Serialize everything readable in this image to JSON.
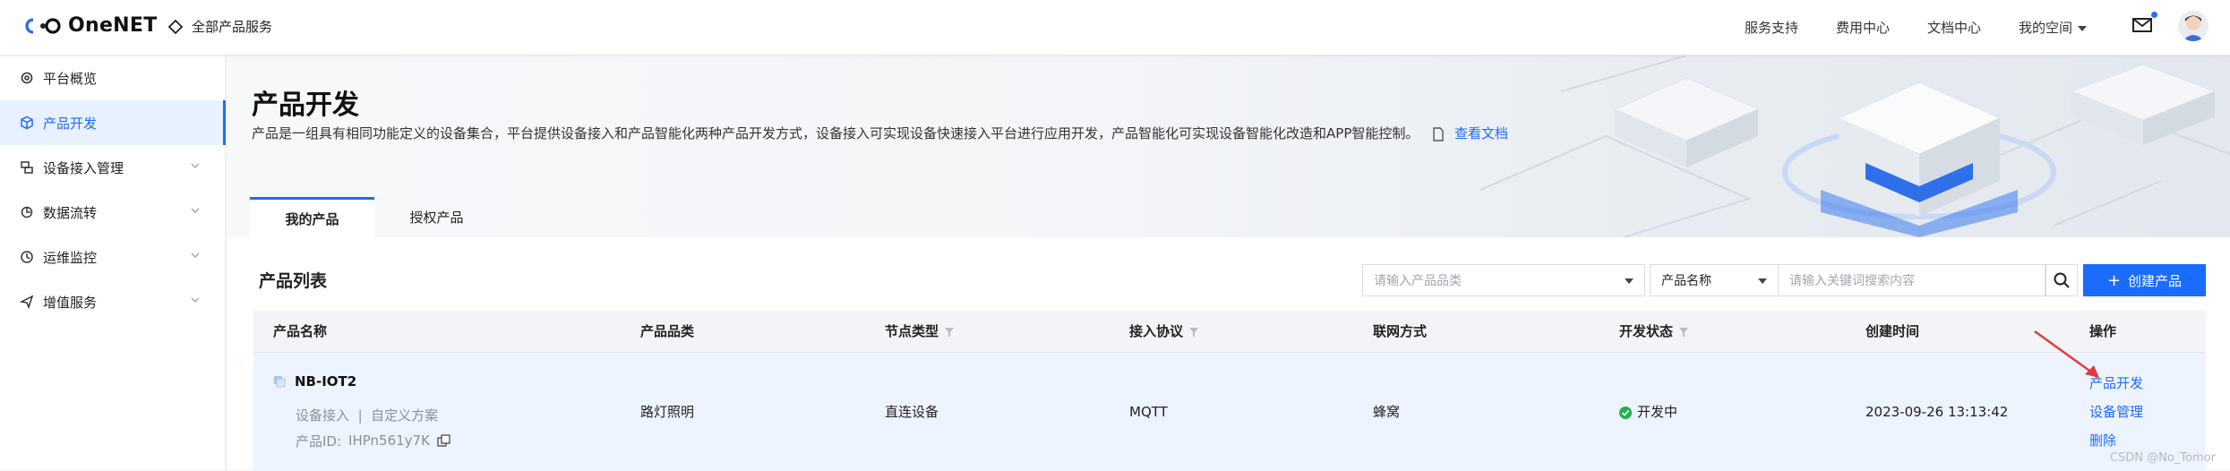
{
  "topbar": {
    "logo_text": "OneNET",
    "all_products": "全部产品服务",
    "links": [
      "服务支持",
      "费用中心",
      "文档中心"
    ],
    "my_space": "我的空间"
  },
  "sidebar": {
    "items": [
      {
        "label": "平台概览",
        "icon": "gear-icon",
        "expandable": false
      },
      {
        "label": "产品开发",
        "icon": "cube-icon",
        "expandable": false
      },
      {
        "label": "设备接入管理",
        "icon": "devices-icon",
        "expandable": true
      },
      {
        "label": "数据流转",
        "icon": "flow-icon",
        "expandable": true
      },
      {
        "label": "运维监控",
        "icon": "clock-monitor-icon",
        "expandable": true
      },
      {
        "label": "增值服务",
        "icon": "send-icon",
        "expandable": true
      }
    ],
    "active_index": 1
  },
  "banner": {
    "title": "产品开发",
    "description": "产品是一组具有相同功能定义的设备集合，平台提供设备接入和产品智能化两种产品开发方式，设备接入可实现设备快速接入平台进行应用开发，产品智能化可实现设备智能化改造和APP智能控制。",
    "doc_link": "查看文档",
    "tabs": [
      "我的产品",
      "授权产品"
    ],
    "active_tab": 0
  },
  "list": {
    "title": "产品列表",
    "category_placeholder": "请输入产品品类",
    "field_select": "产品名称",
    "keyword_placeholder": "请输入关键词搜索内容",
    "create_button": "创建产品",
    "columns": [
      "产品名称",
      "产品品类",
      "节点类型",
      "接入协议",
      "联网方式",
      "开发状态",
      "创建时间",
      "操作"
    ],
    "rows": [
      {
        "name": "NB-IOT2",
        "sub_left": "设备接入",
        "sub_sep": "|",
        "sub_right": "自定义方案",
        "product_id_label": "产品ID:",
        "product_id": "IHPn561y7K",
        "category": "路灯照明",
        "node_type": "直连设备",
        "protocol": "MQTT",
        "network": "蜂窝",
        "status": "开发中",
        "created": "2023-09-26 13:13:42",
        "ops": [
          "产品开发",
          "设备管理",
          "删除"
        ]
      }
    ]
  },
  "watermark": "CSDN @No_Tomor",
  "colors": {
    "accent": "#1a6cff",
    "status_green": "#21b24b",
    "arrow_red": "#e23b3b"
  }
}
